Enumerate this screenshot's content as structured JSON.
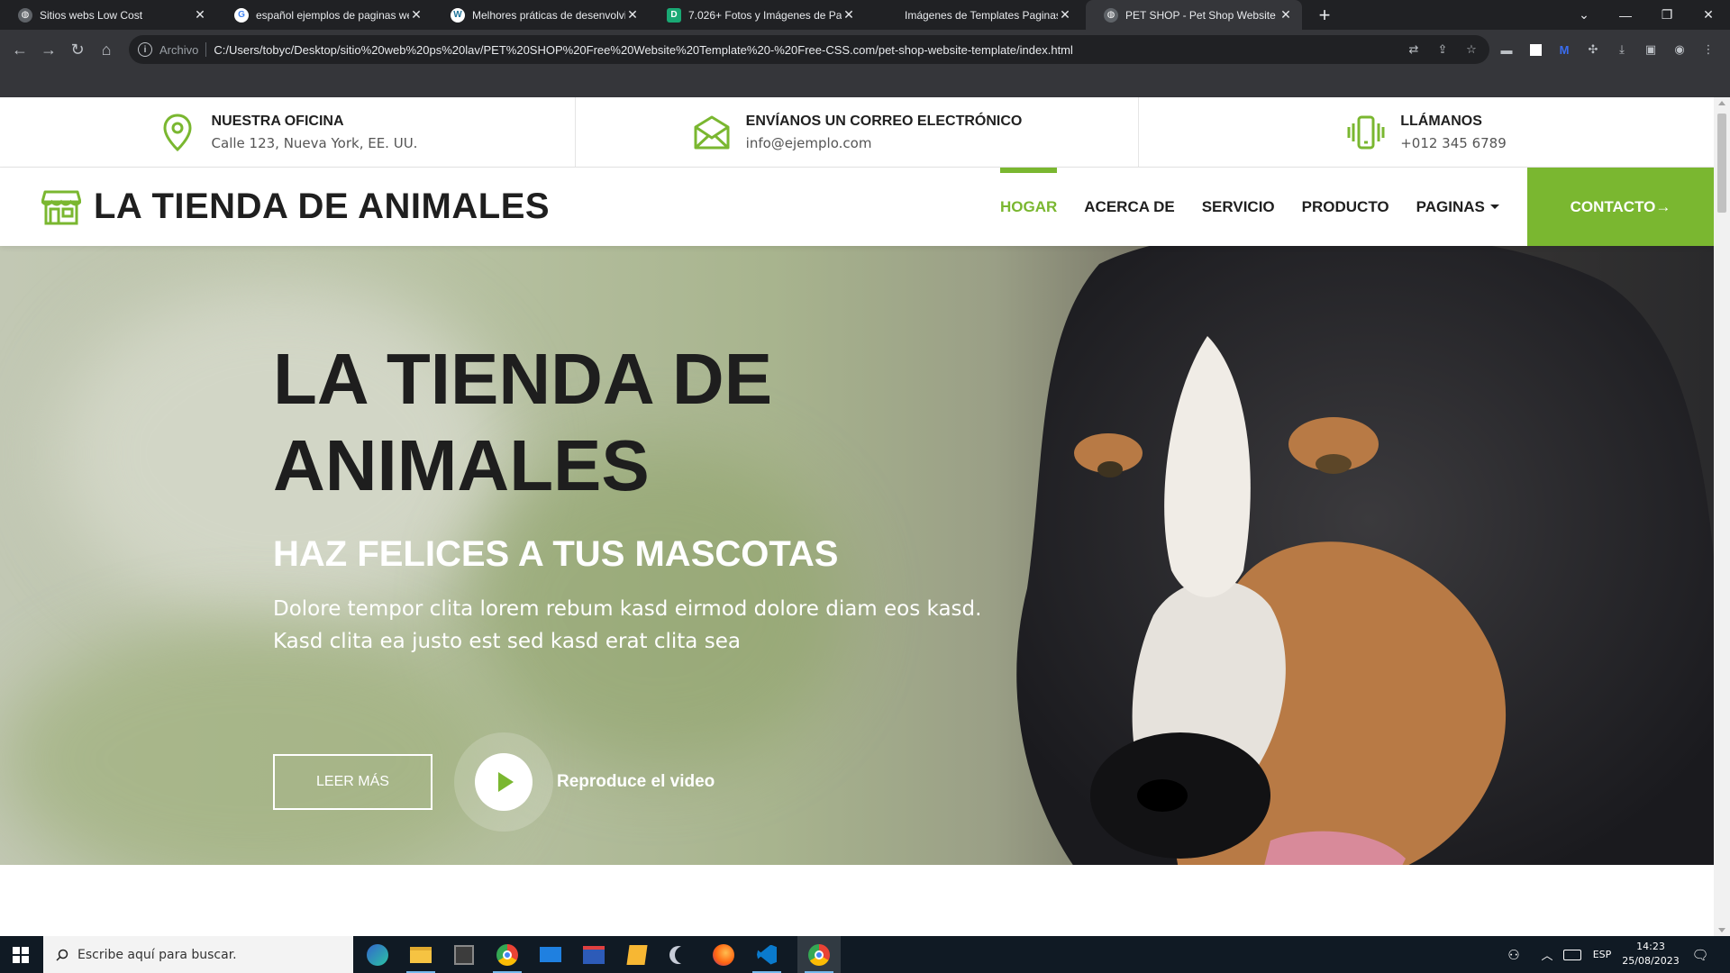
{
  "browser": {
    "tabs": [
      {
        "title": "Sitios webs Low Cost",
        "active": false
      },
      {
        "title": "español ejemplos de paginas web",
        "active": false
      },
      {
        "title": "Melhores práticas de desenvolvimento",
        "active": false
      },
      {
        "title": "7.026+ Fotos y Imágenes de Pagina",
        "active": false
      },
      {
        "title": "Imágenes de Templates Paginas Web",
        "active": false
      },
      {
        "title": "PET SHOP - Pet Shop Website Template",
        "active": true
      }
    ],
    "address": {
      "scheme_label": "Archivo",
      "url": "C:/Users/tobyc/Desktop/sitio%20web%20ps%20lav/PET%20SHOP%20Free%20Website%20Template%20-%20Free-CSS.com/pet-shop-website-template/index.html"
    }
  },
  "page": {
    "topbar": {
      "office": {
        "title": "NUESTRA OFICINA",
        "value": "Calle 123, Nueva York, EE. UU."
      },
      "email": {
        "title": "ENVÍANOS UN CORREO ELECTRÓNICO",
        "value": "info@ejemplo.com"
      },
      "phone": {
        "title": "LLÁMANOS",
        "value": "+012 345 6789"
      }
    },
    "navbar": {
      "brand": "LA TIENDA DE ANIMALES",
      "items": [
        "HOGAR",
        "ACERCA DE",
        "SERVICIO",
        "PRODUCTO",
        "PAGINAS"
      ],
      "active_item": "HOGAR",
      "cta": "CONTACTO→"
    },
    "hero": {
      "title": "LA TIENDA DE ANIMALES",
      "subtitle": "HAZ FELICES A TUS MASCOTAS",
      "text_line1": "Dolore tempor clita lorem rebum kasd eirmod dolore diam eos kasd.",
      "text_line2": "Kasd clita ea justo est sed kasd erat clita sea",
      "read_more": "LEER MÁS",
      "play_label": "Reproduce el video"
    }
  },
  "taskbar": {
    "search_placeholder": "Escribe aquí para buscar.",
    "language": "ESP",
    "time": "14:23",
    "date": "25/08/2023"
  },
  "colors": {
    "accent": "#7ab730",
    "dark_text": "#1f1f1f"
  }
}
